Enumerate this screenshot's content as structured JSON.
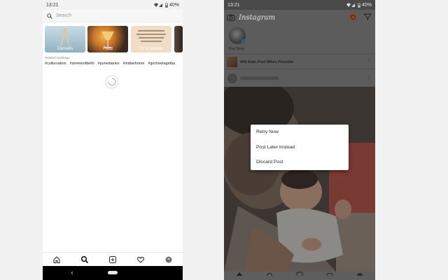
{
  "left_phone": {
    "status": {
      "time": "13:21",
      "battery": "40%"
    },
    "search": {
      "placeholder": "Search"
    },
    "tiles": [
      {
        "label": "Dancers"
      },
      {
        "label": "Food"
      },
      {
        "label": "TV & Movies"
      },
      {
        "label": ""
      }
    ],
    "related_title": "Related Hashtags",
    "hashtags": [
      "#culturvation",
      "#streetsofdelhi",
      "#punediaries",
      "#indianhome",
      "#gocheetagetba"
    ],
    "nav_icons": [
      "home-icon",
      "search-icon",
      "add-icon",
      "heart-icon",
      "profile-icon"
    ]
  },
  "right_phone": {
    "status": {
      "time": "13:21",
      "battery": "40%"
    },
    "app_title": "Instagram",
    "story_label": "Your Story",
    "posting_text": "Will Auto-Post When Possible",
    "dialog": {
      "items": [
        "Retry Now",
        "Post Later Instead",
        "Discard Post"
      ]
    }
  },
  "colors": {
    "dim_overlay": "#5a5a5a",
    "dialog_bg": "#ffffff",
    "nav_bar": "#000000",
    "background": "#f1f1f1"
  }
}
